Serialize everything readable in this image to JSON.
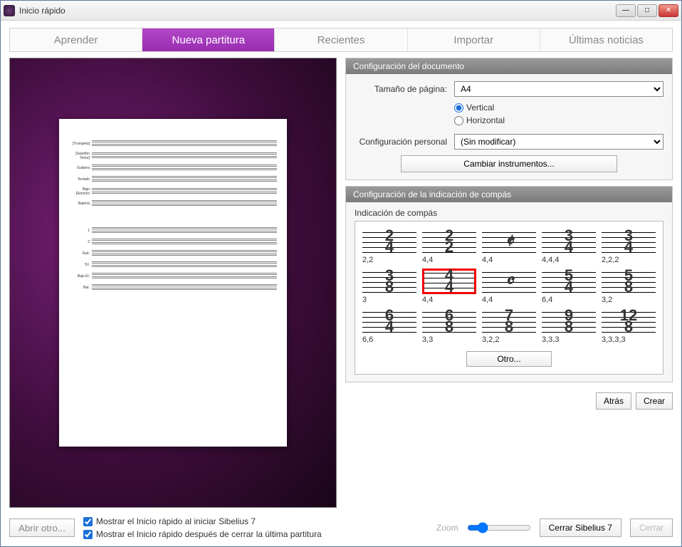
{
  "window": {
    "title": "Inicio rápido"
  },
  "tabs": {
    "learn": "Aprender",
    "newscore": "Nueva partitura",
    "recent": "Recientes",
    "import": "Importar",
    "news": "Últimas noticias",
    "active": "newscore"
  },
  "preview": {
    "instruments_top": [
      "[Trompeta]",
      "[Saxofón Tenor]",
      "Guitarra",
      "Teclado",
      "Bajo Eléctrico",
      "Batería"
    ],
    "instruments_bottom": [
      "1",
      "2",
      "Guit.",
      "Tcl.",
      "Bajo El.",
      "Bat."
    ]
  },
  "doc_config": {
    "header": "Configuración del documento",
    "page_size_label": "Tamaño de página:",
    "page_size_value": "A4",
    "orientation": {
      "vertical": "Vertical",
      "horizontal": "Horizontal",
      "selected": "vertical"
    },
    "personal_label": "Configuración personal",
    "personal_value": "(Sin modificar)",
    "change_instruments": "Cambiar instrumentos..."
  },
  "ts_config": {
    "header": "Configuración de la indicación de compás",
    "group_label": "Indicación de compás",
    "options": [
      {
        "top": "2",
        "bot": "4",
        "caption": "2,2"
      },
      {
        "top": "2",
        "bot": "2",
        "caption": "4,4"
      },
      {
        "sym": "𝄵",
        "caption": "4,4"
      },
      {
        "top": "3",
        "bot": "4",
        "caption": "4,4,4"
      },
      {
        "top": "3",
        "bot": "4",
        "caption": "2,2,2"
      },
      {
        "top": "3",
        "bot": "8",
        "caption": "3"
      },
      {
        "top": "4",
        "bot": "4",
        "caption": "4,4",
        "selected": true
      },
      {
        "sym": "𝄴",
        "caption": "4,4"
      },
      {
        "top": "5",
        "bot": "4",
        "caption": "6,4"
      },
      {
        "top": "5",
        "bot": "8",
        "caption": "3,2"
      },
      {
        "top": "6",
        "bot": "4",
        "caption": "6,6"
      },
      {
        "top": "6",
        "bot": "8",
        "caption": "3,3"
      },
      {
        "top": "7",
        "bot": "8",
        "caption": "3,2,2"
      },
      {
        "top": "9",
        "bot": "8",
        "caption": "3,3,3"
      },
      {
        "top": "12",
        "bot": "8",
        "caption": "3,3,3,3"
      }
    ],
    "other": "Otro..."
  },
  "nav": {
    "back": "Atrás",
    "create": "Crear"
  },
  "footer": {
    "open_other": "Abrir otro...",
    "check1": "Mostrar el Inicio rápido al iniciar Sibelius 7",
    "check2": "Mostrar el Inicio rápido después de cerrar la última partitura",
    "zoom_label": "Zoom",
    "close_app": "Cerrar Sibelius 7",
    "close": "Cerrar"
  }
}
